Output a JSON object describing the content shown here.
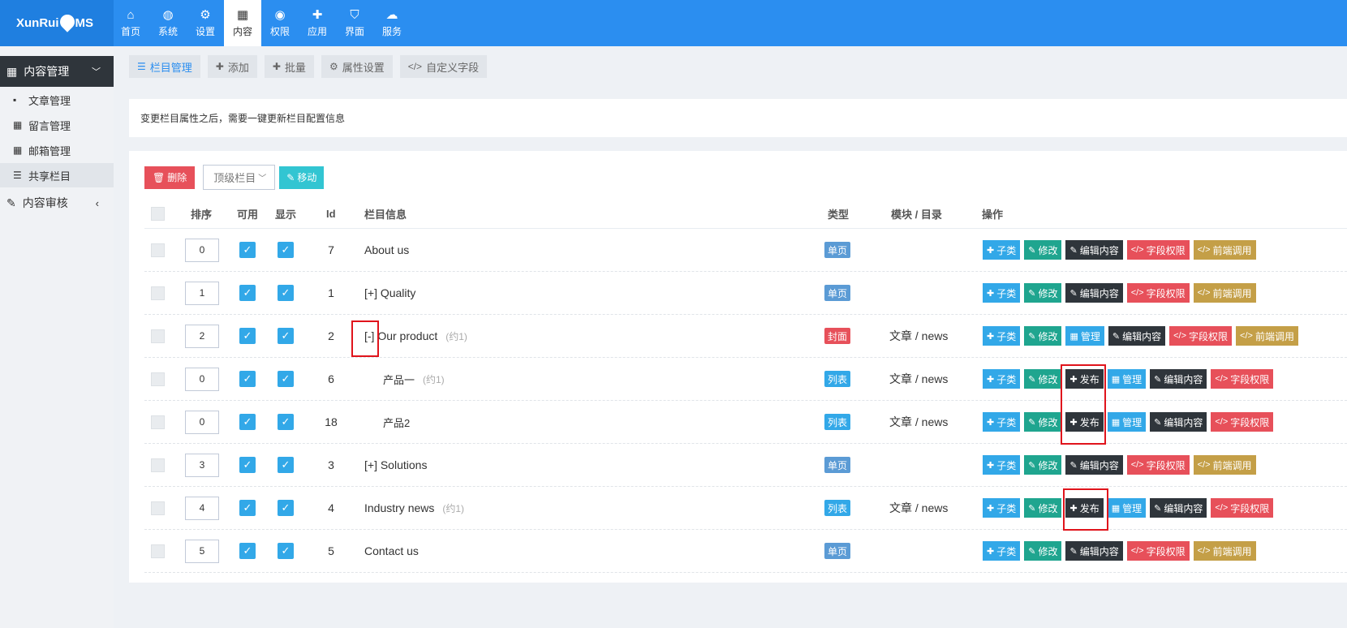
{
  "brand": {
    "logo_text_left": "XunRui",
    "logo_text_right": "MS"
  },
  "nav": [
    {
      "label": "首页",
      "icon": "home-icon",
      "glyph": "⌂",
      "active": false
    },
    {
      "label": "系统",
      "icon": "globe-icon",
      "glyph": "◍",
      "active": false
    },
    {
      "label": "设置",
      "icon": "gears-icon",
      "glyph": "⚙",
      "active": false
    },
    {
      "label": "内容",
      "icon": "grid-icon",
      "glyph": "▦",
      "active": true
    },
    {
      "label": "权限",
      "icon": "user-circle-icon",
      "glyph": "◉",
      "active": false
    },
    {
      "label": "应用",
      "icon": "puzzle-icon",
      "glyph": "✚",
      "active": false
    },
    {
      "label": "界面",
      "icon": "html5-icon",
      "glyph": "⛉",
      "active": false
    },
    {
      "label": "服务",
      "icon": "cloud-icon",
      "glyph": "☁",
      "active": false
    }
  ],
  "sidebar": {
    "head": "内容管理",
    "items": [
      {
        "label": "文章管理",
        "icon": "sticky-note-icon",
        "glyph": "▪"
      },
      {
        "label": "留言管理",
        "icon": "table-icon",
        "glyph": "▦"
      },
      {
        "label": "邮箱管理",
        "icon": "table-icon",
        "glyph": "▦"
      },
      {
        "label": "共享栏目",
        "icon": "list-icon",
        "glyph": "☰"
      }
    ],
    "group": "内容审核"
  },
  "tabs": [
    {
      "label": "栏目管理",
      "icon": "list-icon",
      "glyph": "☰"
    },
    {
      "label": "添加",
      "icon": "plus-icon",
      "glyph": "✚"
    },
    {
      "label": "批量",
      "icon": "plus-icon",
      "glyph": "✚"
    },
    {
      "label": "属性设置",
      "icon": "gear-icon",
      "glyph": "⚙"
    },
    {
      "label": "自定义字段",
      "icon": "code-icon",
      "glyph": "</>"
    }
  ],
  "notice": "变更栏目属性之后，需要一键更新栏目配置信息",
  "toolbar": {
    "delete": "删除",
    "select": "顶级栏目",
    "move": "移动"
  },
  "table": {
    "headers": {
      "order": "排序",
      "usable": "可用",
      "show": "显示",
      "id": "Id",
      "info": "栏目信息",
      "type": "类型",
      "module": "模块 / 目录",
      "ops": "操作"
    },
    "rows": [
      {
        "order": "0",
        "id": "7",
        "name": "About us",
        "hint": "",
        "indent": 0,
        "type": "单页",
        "type_color": "#5b9bd5",
        "module": "",
        "ops": [
          "sub",
          "edit",
          "editcontent",
          "perm",
          "front"
        ]
      },
      {
        "order": "1",
        "id": "1",
        "name": "[+] Quality",
        "hint": "",
        "indent": 0,
        "type": "单页",
        "type_color": "#5b9bd5",
        "module": "",
        "ops": [
          "sub",
          "edit",
          "editcontent",
          "perm",
          "front"
        ]
      },
      {
        "order": "2",
        "id": "2",
        "name": "[-] Our product",
        "hint": "(约1)",
        "indent": 0,
        "type": "封面",
        "type_color": "#e7505a",
        "module": "文章 / news",
        "ops": [
          "sub",
          "edit",
          "manage",
          "editcontent",
          "perm",
          "front"
        ]
      },
      {
        "order": "0",
        "id": "6",
        "name": "产品一",
        "hint": "(约1)",
        "indent": 1,
        "type": "列表",
        "type_color": "#32a8e8",
        "module": "文章 / news",
        "ops": [
          "sub",
          "edit",
          "publish",
          "manage",
          "editcontent",
          "perm"
        ]
      },
      {
        "order": "0",
        "id": "18",
        "name": "产品2",
        "hint": "",
        "indent": 1,
        "type": "列表",
        "type_color": "#32a8e8",
        "module": "文章 / news",
        "ops": [
          "sub",
          "edit",
          "publish",
          "manage",
          "editcontent",
          "perm"
        ]
      },
      {
        "order": "3",
        "id": "3",
        "name": "[+] Solutions",
        "hint": "",
        "indent": 0,
        "type": "单页",
        "type_color": "#5b9bd5",
        "module": "",
        "ops": [
          "sub",
          "edit",
          "editcontent",
          "perm",
          "front"
        ]
      },
      {
        "order": "4",
        "id": "4",
        "name": "Industry news",
        "hint": "(约1)",
        "indent": 0,
        "type": "列表",
        "type_color": "#32a8e8",
        "module": "文章 / news",
        "ops": [
          "sub",
          "edit",
          "publish",
          "manage",
          "editcontent",
          "perm"
        ]
      },
      {
        "order": "5",
        "id": "5",
        "name": "Contact us",
        "hint": "",
        "indent": 0,
        "type": "单页",
        "type_color": "#5b9bd5",
        "module": "",
        "ops": [
          "sub",
          "edit",
          "editcontent",
          "perm",
          "front"
        ]
      }
    ]
  },
  "op_defs": {
    "sub": {
      "label": "子类",
      "glyph": "✚",
      "color": "#32a8e8",
      "icon": "plus-icon"
    },
    "edit": {
      "label": "修改",
      "glyph": "✎",
      "color": "#1fa58f",
      "icon": "edit-icon"
    },
    "manage": {
      "label": "管理",
      "glyph": "▦",
      "color": "#32a8e8",
      "icon": "grid-icon"
    },
    "publish": {
      "label": "发布",
      "glyph": "✚",
      "color": "#2f353b",
      "icon": "plus-icon"
    },
    "editcontent": {
      "label": "编辑内容",
      "glyph": "✎",
      "color": "#2f353b",
      "icon": "edit-icon"
    },
    "perm": {
      "label": "字段权限",
      "glyph": "</>",
      "color": "#e7505a",
      "icon": "code-icon"
    },
    "front": {
      "label": "前端调用",
      "glyph": "</>",
      "color": "#c49f47",
      "icon": "code-icon"
    }
  }
}
